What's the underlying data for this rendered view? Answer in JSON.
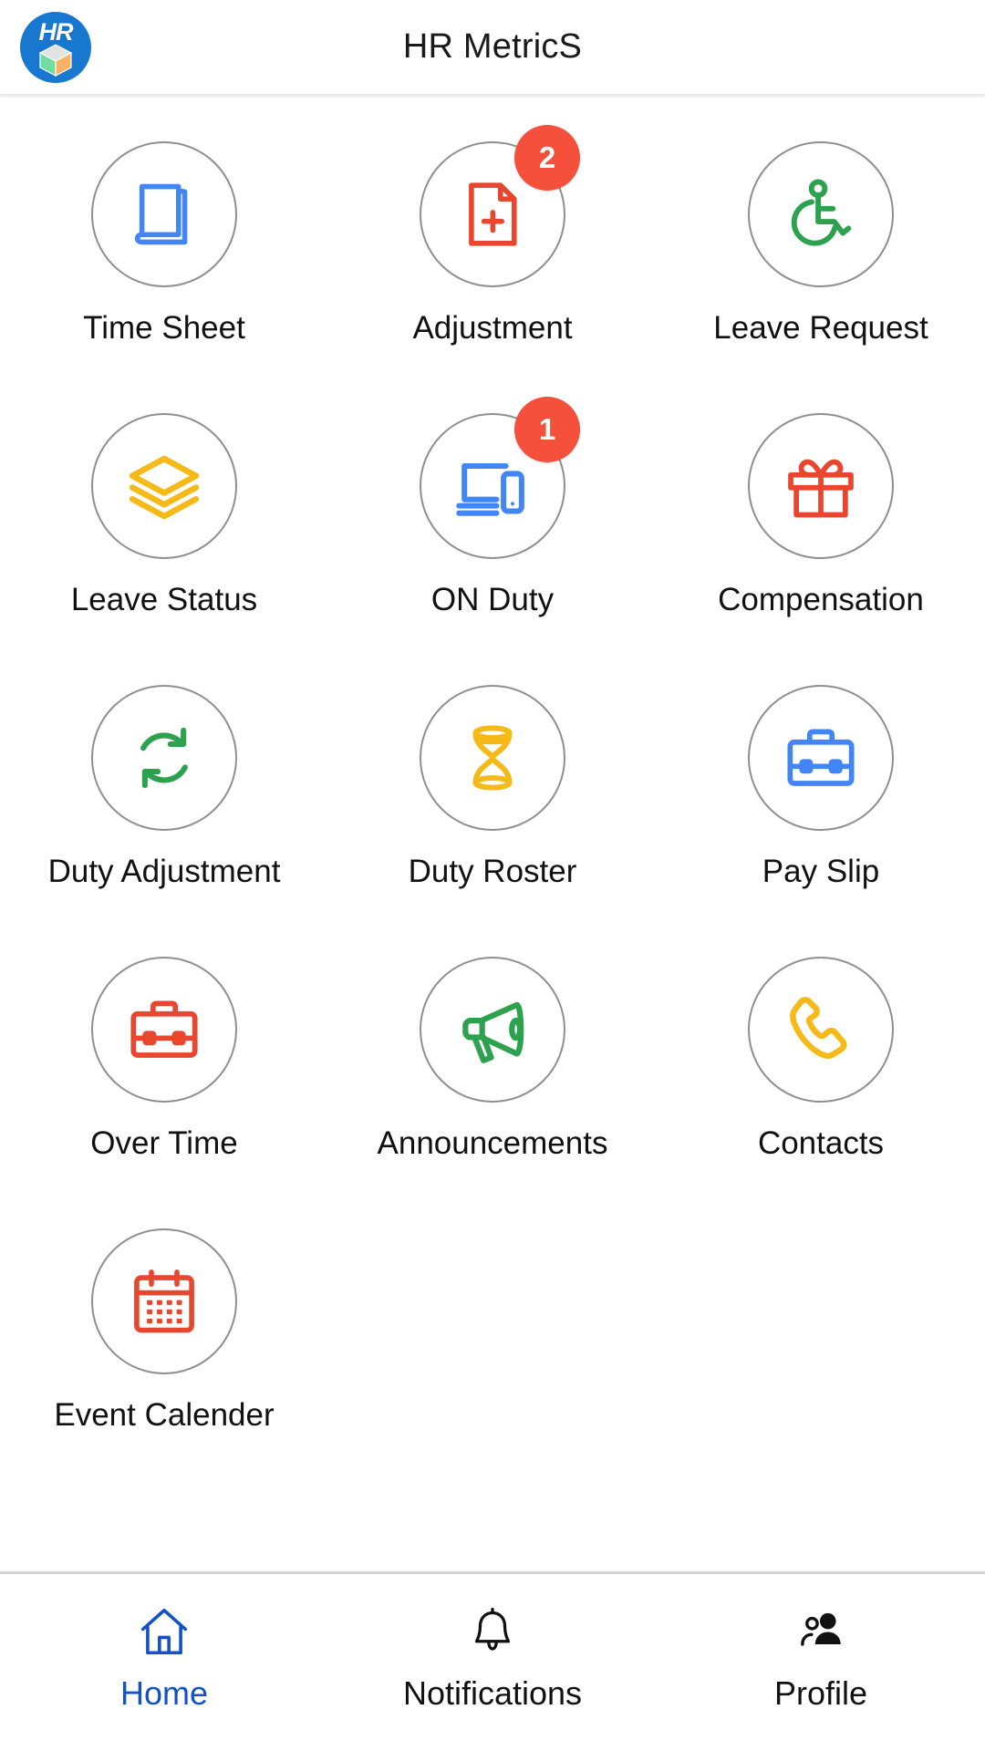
{
  "header": {
    "title": "HR MetricS",
    "logo_text": "HR",
    "logo_bg": "#1878cf"
  },
  "colors": {
    "badge": "#f4503c",
    "blue": "#4285f4",
    "red": "#e8462f",
    "green": "#2ca14e",
    "yellow": "#f5ba18",
    "circle_border": "#8f8f8f",
    "nav_active": "#1352c4"
  },
  "grid": {
    "tiles": [
      {
        "label": "Time Sheet",
        "icon": "book-icon",
        "color": "#4285f4",
        "badge": null
      },
      {
        "label": "Adjustment",
        "icon": "document-plus-icon",
        "color": "#e8462f",
        "badge": "2"
      },
      {
        "label": "Leave Request",
        "icon": "wheelchair-icon",
        "color": "#2ca14e",
        "badge": null
      },
      {
        "label": "Leave Status",
        "icon": "layers-icon",
        "color": "#f5ba18",
        "badge": null
      },
      {
        "label": "ON Duty",
        "icon": "devices-icon",
        "color": "#4285f4",
        "badge": "1"
      },
      {
        "label": "Compensation",
        "icon": "gift-icon",
        "color": "#e8462f",
        "badge": null
      },
      {
        "label": "Duty Adjustment",
        "icon": "refresh-icon",
        "color": "#2ca14e",
        "badge": null
      },
      {
        "label": "Duty Roster",
        "icon": "hourglass-icon",
        "color": "#f5ba18",
        "badge": null
      },
      {
        "label": "Pay Slip",
        "icon": "briefcase-icon",
        "color": "#4285f4",
        "badge": null
      },
      {
        "label": "Over Time",
        "icon": "briefcase-icon",
        "color": "#e8462f",
        "badge": null
      },
      {
        "label": "Announcements",
        "icon": "megaphone-icon",
        "color": "#2ca14e",
        "badge": null
      },
      {
        "label": "Contacts",
        "icon": "phone-icon",
        "color": "#f5ba18",
        "badge": null
      },
      {
        "label": "Event Calender",
        "icon": "calendar-icon",
        "color": "#e8462f",
        "badge": null
      }
    ]
  },
  "bottom_nav": {
    "items": [
      {
        "label": "Home",
        "icon": "home-icon",
        "active": true
      },
      {
        "label": "Notifications",
        "icon": "bell-icon",
        "active": false
      },
      {
        "label": "Profile",
        "icon": "people-icon",
        "active": false
      }
    ]
  }
}
